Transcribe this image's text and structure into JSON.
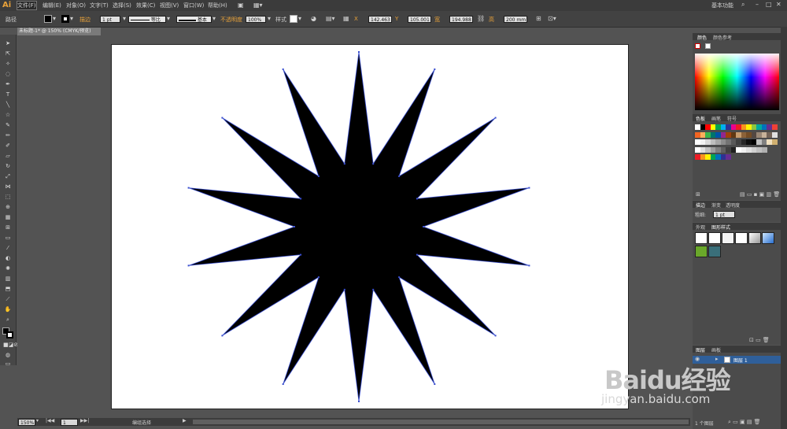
{
  "app": {
    "logo": "Ai",
    "workspace": "基本功能",
    "search_icon": "search-icon"
  },
  "menu": [
    "文件(F)",
    "编辑(E)",
    "对象(O)",
    "文字(T)",
    "选择(S)",
    "效果(C)",
    "视图(V)",
    "窗口(W)",
    "帮助(H)"
  ],
  "control_bar": {
    "selection_label": "路径",
    "stroke_label": "描边",
    "stroke_weight": "1 pt",
    "profile_label": "等比",
    "brush_label": "基本",
    "opacity_label": "不透明度",
    "opacity_value": "100%",
    "style_label": "样式",
    "x_label": "X",
    "x_value": "142.463 m",
    "y_label": "Y",
    "y_value": "105.001 m",
    "w_label": "宽",
    "w_value": "194.988 m",
    "h_label": "高",
    "h_value": "200 mm"
  },
  "document": {
    "tab_title": "未标题-1* @ 150% (CMYK/预览)"
  },
  "status": {
    "zoom": "150%",
    "artboard_num": "1",
    "status_text": "编组选择"
  },
  "panels": {
    "color": {
      "tabs": [
        "颜色",
        "颜色参考"
      ]
    },
    "swatches": {
      "tabs": [
        "色板",
        "画笔",
        "符号"
      ]
    },
    "stroke": {
      "tabs": [
        "描边",
        "渐变",
        "透明度"
      ],
      "weight_label": "粗细:",
      "weight_value": "1 pt"
    },
    "graphic_styles": {
      "tabs": [
        "外观",
        "图形样式"
      ]
    },
    "layers": {
      "tabs": [
        "图层",
        "画板"
      ],
      "layer_name": "图层 1",
      "footer": "1 个图层"
    }
  },
  "colors": {
    "accent": "#e8a23a",
    "layer_highlight": "#2f5f9a",
    "star_fill": "#000000",
    "anchor_color": "#3a4fd0"
  },
  "watermark": {
    "brand": "Baidu经验",
    "url": "jingyan.baidu.com"
  }
}
